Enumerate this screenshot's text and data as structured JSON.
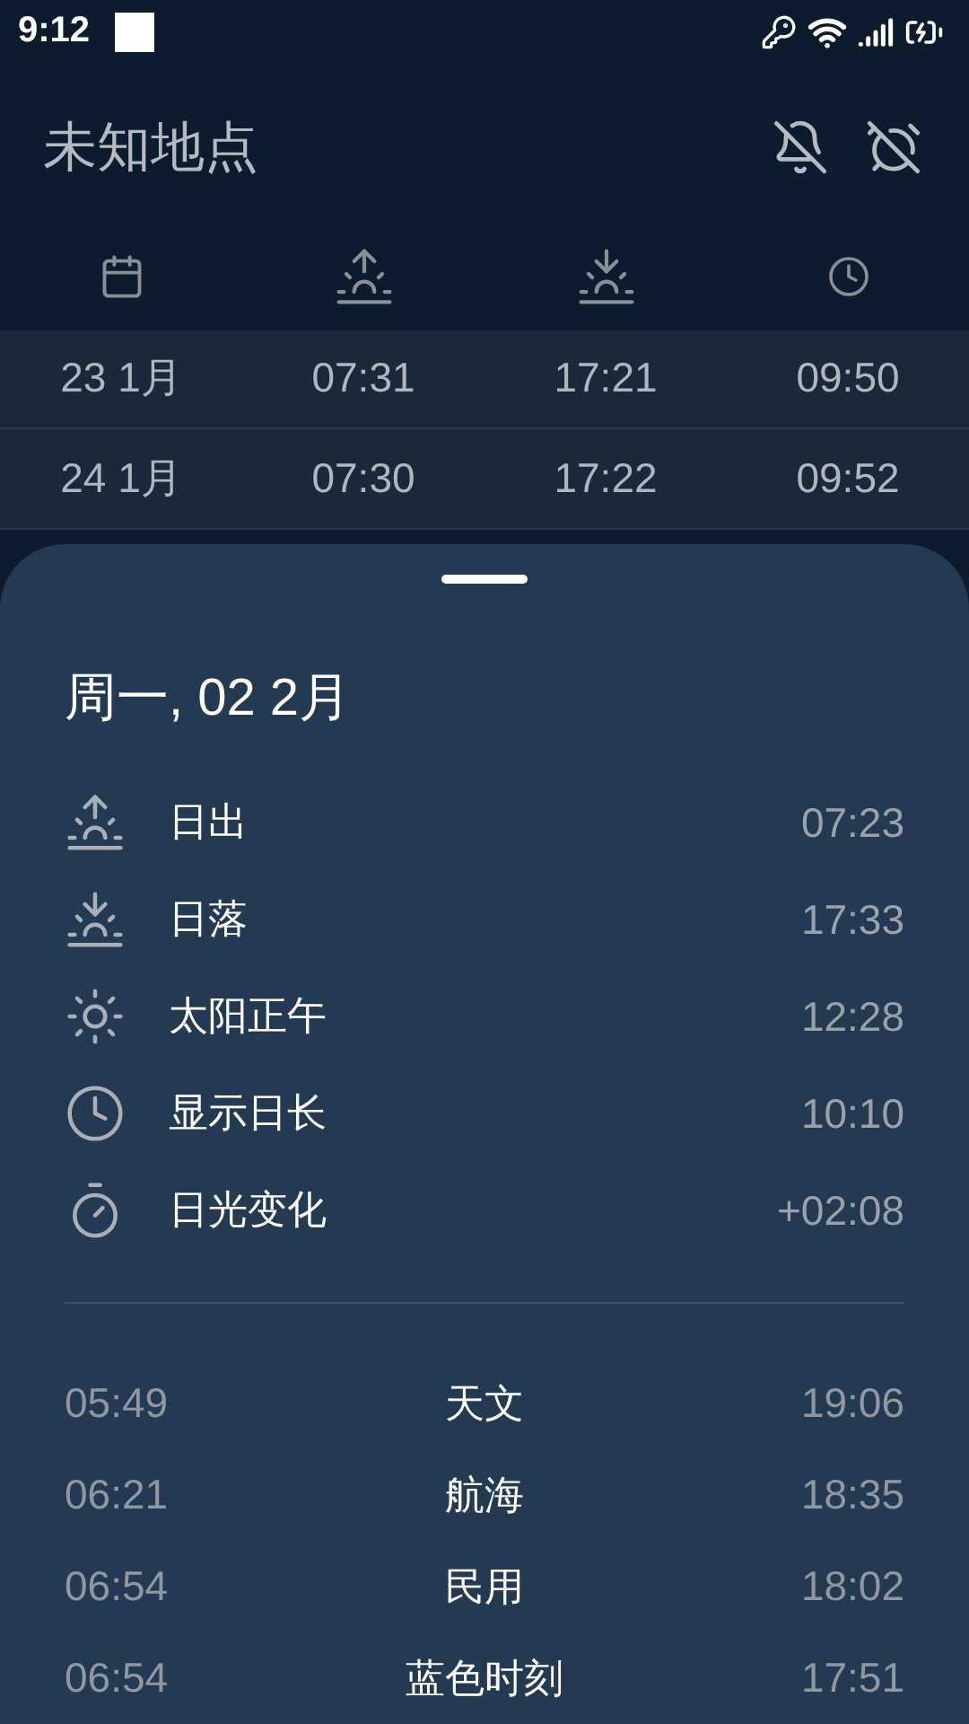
{
  "status_bar": {
    "time": "9:12"
  },
  "app_bar": {
    "title": "未知地点"
  },
  "table": {
    "rows": [
      {
        "cells": [
          "23 1月",
          "07:31",
          "17:21",
          "09:50"
        ]
      },
      {
        "cells": [
          "24 1月",
          "07:30",
          "17:22",
          "09:52"
        ]
      }
    ]
  },
  "sheet": {
    "date_title": "周一, 02 2月",
    "details": [
      {
        "kind": "sunrise",
        "label": "日出",
        "value": "07:23"
      },
      {
        "kind": "sunset",
        "label": "日落",
        "value": "17:33"
      },
      {
        "kind": "noon",
        "label": "太阳正午",
        "value": "12:28"
      },
      {
        "kind": "day_length",
        "label": "显示日长",
        "value": "10:10"
      },
      {
        "kind": "change",
        "label": "日光变化",
        "value": "+02:08"
      }
    ],
    "twilight": [
      {
        "start": "05:49",
        "name": "天文",
        "end": "19:06"
      },
      {
        "start": "06:21",
        "name": "航海",
        "end": "18:35"
      },
      {
        "start": "06:54",
        "name": "民用",
        "end": "18:02"
      },
      {
        "start": "06:54",
        "name": "蓝色时刻",
        "end": "17:51"
      }
    ]
  }
}
